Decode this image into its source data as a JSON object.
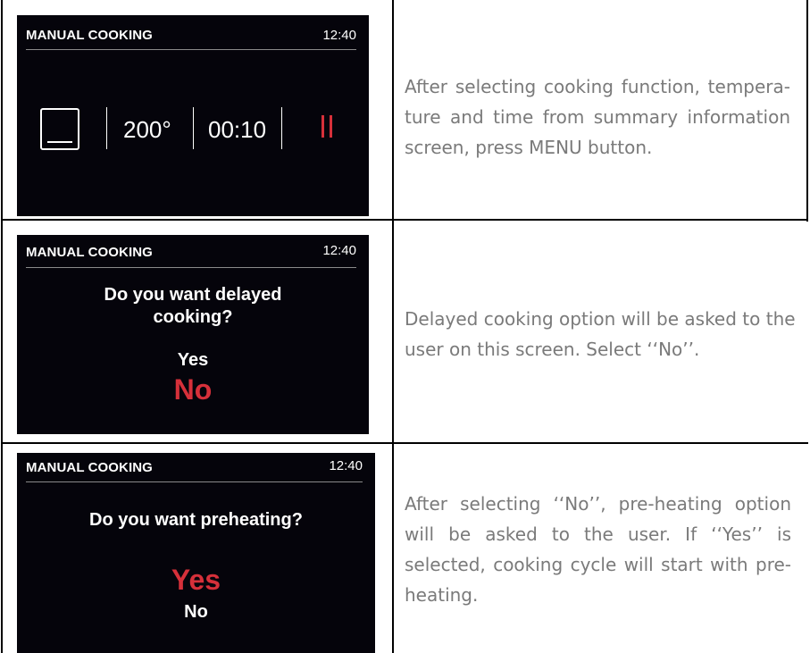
{
  "rows": [
    {
      "screen": {
        "title": "MANUAL COOKING",
        "time": "12:40",
        "temperature": "200°",
        "duration": "00:10"
      },
      "description": "After selecting cooking function, tempera- ture and time from summary information screen, press MENU button."
    },
    {
      "screen": {
        "title": "MANUAL COOKING",
        "time": "12:40",
        "question_line1": "Do you want delayed",
        "question_line2": "cooking?",
        "option_yes": "Yes",
        "option_no": "No",
        "selected": "No"
      },
      "description": "Delayed cooking option will be asked to the user on this screen. Select ‘‘No’’."
    },
    {
      "screen": {
        "title": "MANUAL COOKING",
        "time": "12:40",
        "question": "Do you want preheating?",
        "option_yes": "Yes",
        "option_no": "No",
        "selected": "Yes"
      },
      "description": "After selecting ‘‘No’’, pre-heating option will be asked to the user. If ‘‘Yes’’ is selected, cooking cycle will start with pre-heating."
    }
  ],
  "icons": {
    "oven": "oven-icon",
    "pause": "pause-icon"
  },
  "colors": {
    "screen_background": "#05040b",
    "highlight": "#d6303a",
    "description_text": "#7a7a7a"
  }
}
